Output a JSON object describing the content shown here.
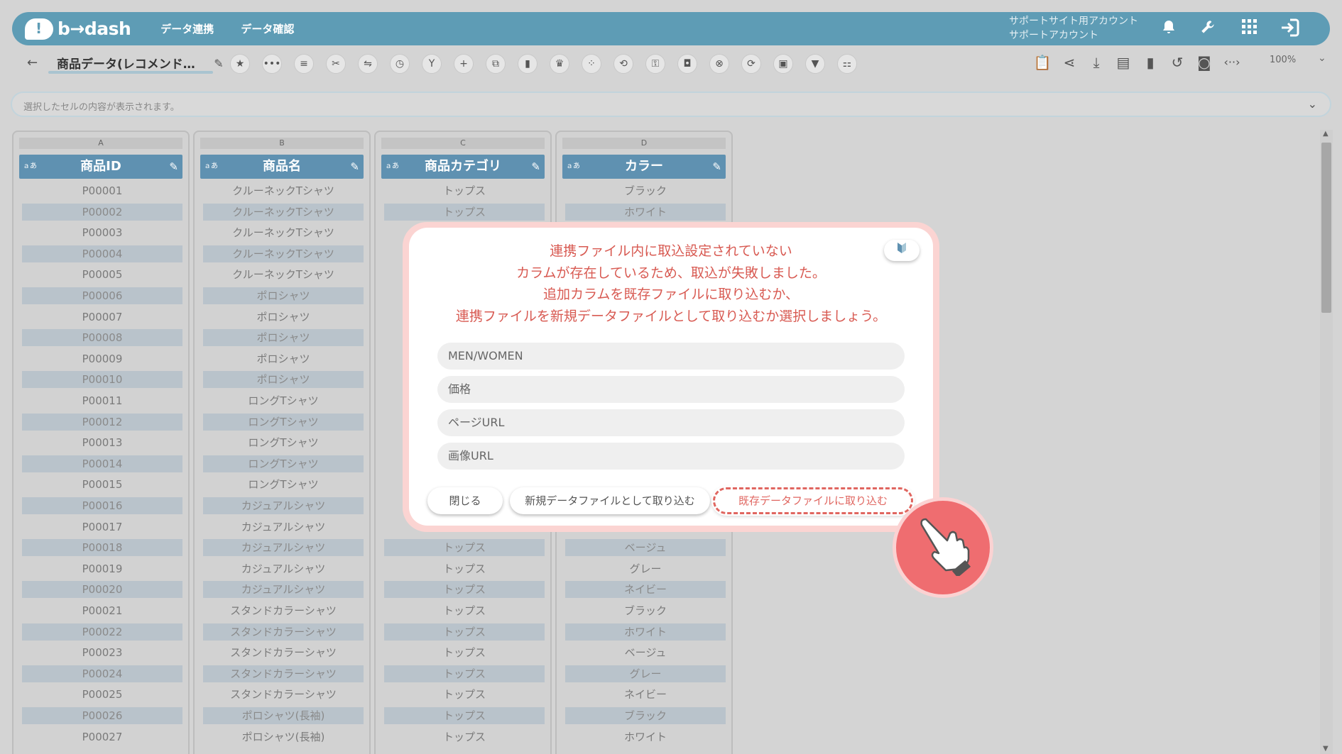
{
  "header": {
    "logo_text": "b→dash",
    "nav": [
      "データ連携",
      "データ確認"
    ],
    "account_line1": "サポートサイト用アカウント",
    "account_line2": "サポートアカウント",
    "icons": [
      "bell-icon",
      "wrench-icon",
      "apps-grid-icon",
      "logout-icon"
    ]
  },
  "toolbar": {
    "back_icon": "←",
    "doc_title": "商品データ(レコメンド…",
    "zoom": "100%"
  },
  "cell_viewer": {
    "placeholder": "選択したセルの内容が表示されます。"
  },
  "grid": {
    "columns": [
      {
        "letter": "A",
        "header": "商品ID",
        "type_label": "ａあ"
      },
      {
        "letter": "B",
        "header": "商品名",
        "type_label": "ａあ"
      },
      {
        "letter": "C",
        "header": "商品カテゴリ",
        "type_label": "ａあ"
      },
      {
        "letter": "D",
        "header": "カラー",
        "type_label": "ａあ"
      }
    ],
    "colA": [
      "P00001",
      "P00002",
      "P00003",
      "P00004",
      "P00005",
      "P00006",
      "P00007",
      "P00008",
      "P00009",
      "P00010",
      "P00011",
      "P00012",
      "P00013",
      "P00014",
      "P00015",
      "P00016",
      "P00017",
      "P00018",
      "P00019",
      "P00020",
      "P00021",
      "P00022",
      "P00023",
      "P00024",
      "P00025",
      "P00026",
      "P00027"
    ],
    "colB": [
      "クルーネックTシャツ",
      "クルーネックTシャツ",
      "クルーネックTシャツ",
      "クルーネックTシャツ",
      "クルーネックTシャツ",
      "ポロシャツ",
      "ポロシャツ",
      "ポロシャツ",
      "ポロシャツ",
      "ポロシャツ",
      "ロングTシャツ",
      "ロングTシャツ",
      "ロングTシャツ",
      "ロングTシャツ",
      "ロングTシャツ",
      "カジュアルシャツ",
      "カジュアルシャツ",
      "カジュアルシャツ",
      "カジュアルシャツ",
      "カジュアルシャツ",
      "スタンドカラーシャツ",
      "スタンドカラーシャツ",
      "スタンドカラーシャツ",
      "スタンドカラーシャツ",
      "スタンドカラーシャツ",
      "ポロシャツ(長袖)",
      "ポロシャツ(長袖)"
    ],
    "colC_top": [
      "トップス",
      "トップス"
    ],
    "colC_bottom": [
      "トップス",
      "トップス",
      "トップス",
      "トップス",
      "トップス",
      "トップス",
      "トップス",
      "トップス",
      "トップス",
      "トップス"
    ],
    "colD_top": [
      "ブラック",
      "ホワイト"
    ],
    "colD_bottom": [
      "ベージュ",
      "グレー",
      "ネイビー",
      "ブラック",
      "ホワイト",
      "ベージュ",
      "グレー",
      "ネイビー",
      "ブラック",
      "ホワイト"
    ]
  },
  "dialog": {
    "message": [
      "連携ファイル内に取込設定されていない",
      "カラムが存在しているため、取込が失敗しました。",
      "追加カラムを既存ファイルに取り込むか、",
      "連携ファイルを新規データファイルとして取り込むか選択しましょう。"
    ],
    "beginner_icon": "beginner-mark-icon",
    "fields": [
      "MEN/WOMEN",
      "価格",
      "ページURL",
      "画像URL"
    ],
    "close_label": "閉じる",
    "new_file_label": "新規データファイルとして取り込む",
    "existing_file_label": "既存データファイルに取り込む"
  },
  "colors": {
    "header_bg": "#5e9cb5",
    "column_header": "#5f91b1",
    "dialog_text": "#d85a52",
    "accent_red": "#e06660",
    "pointer_bg": "#ef6d70"
  }
}
